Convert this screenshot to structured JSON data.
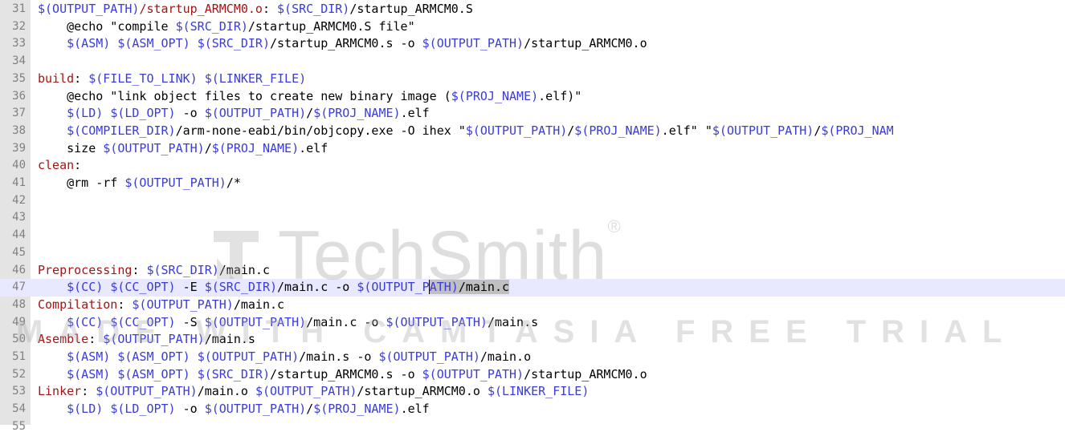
{
  "editor": {
    "current_line": 47,
    "lines": [
      {
        "n": "31",
        "tokens": [
          {
            "t": "$(OUTPUT_PATH)",
            "c": "var"
          },
          {
            "t": "/startup_ARMCM0.o",
            "c": "target"
          },
          {
            "t": ": ",
            "c": "plain"
          },
          {
            "t": "$(SRC_DIR)",
            "c": "var"
          },
          {
            "t": "/startup_ARMCM0.S",
            "c": "plain"
          }
        ]
      },
      {
        "n": "32",
        "tokens": [
          {
            "t": "    @echo \"compile ",
            "c": "plain"
          },
          {
            "t": "$(SRC_DIR)",
            "c": "var"
          },
          {
            "t": "/startup_ARMCM0.S file\"",
            "c": "plain"
          }
        ]
      },
      {
        "n": "33",
        "tokens": [
          {
            "t": "    ",
            "c": "plain"
          },
          {
            "t": "$(ASM)",
            "c": "var"
          },
          {
            "t": " ",
            "c": "plain"
          },
          {
            "t": "$(ASM_OPT)",
            "c": "var"
          },
          {
            "t": " ",
            "c": "plain"
          },
          {
            "t": "$(SRC_DIR)",
            "c": "var"
          },
          {
            "t": "/startup_ARMCM0.s -o ",
            "c": "plain"
          },
          {
            "t": "$(OUTPUT_PATH)",
            "c": "var"
          },
          {
            "t": "/startup_ARMCM0.o",
            "c": "plain"
          }
        ]
      },
      {
        "n": "34",
        "tokens": []
      },
      {
        "n": "35",
        "tokens": [
          {
            "t": "build",
            "c": "target"
          },
          {
            "t": ": ",
            "c": "plain"
          },
          {
            "t": "$(FILE_TO_LINK)",
            "c": "var"
          },
          {
            "t": " ",
            "c": "plain"
          },
          {
            "t": "$(LINKER_FILE)",
            "c": "var"
          }
        ]
      },
      {
        "n": "36",
        "tokens": [
          {
            "t": "    @echo \"link object files to create new binary image (",
            "c": "plain"
          },
          {
            "t": "$(PROJ_NAME)",
            "c": "var"
          },
          {
            "t": ".elf)\"",
            "c": "plain"
          }
        ]
      },
      {
        "n": "37",
        "tokens": [
          {
            "t": "    ",
            "c": "plain"
          },
          {
            "t": "$(LD)",
            "c": "var"
          },
          {
            "t": " ",
            "c": "plain"
          },
          {
            "t": "$(LD_OPT)",
            "c": "var"
          },
          {
            "t": " -o ",
            "c": "plain"
          },
          {
            "t": "$(OUTPUT_PATH)",
            "c": "var"
          },
          {
            "t": "/",
            "c": "plain"
          },
          {
            "t": "$(PROJ_NAME)",
            "c": "var"
          },
          {
            "t": ".elf",
            "c": "plain"
          }
        ]
      },
      {
        "n": "38",
        "tokens": [
          {
            "t": "    ",
            "c": "plain"
          },
          {
            "t": "$(COMPILER_DIR)",
            "c": "var"
          },
          {
            "t": "/arm-none-eabi/bin/objcopy.exe -O ihex \"",
            "c": "plain"
          },
          {
            "t": "$(OUTPUT_PATH)",
            "c": "var"
          },
          {
            "t": "/",
            "c": "plain"
          },
          {
            "t": "$(PROJ_NAME)",
            "c": "var"
          },
          {
            "t": ".elf\" \"",
            "c": "plain"
          },
          {
            "t": "$(OUTPUT_PATH)",
            "c": "var"
          },
          {
            "t": "/",
            "c": "plain"
          },
          {
            "t": "$(PROJ_NAM",
            "c": "var"
          }
        ]
      },
      {
        "n": "39",
        "tokens": [
          {
            "t": "    size ",
            "c": "plain"
          },
          {
            "t": "$(OUTPUT_PATH)",
            "c": "var"
          },
          {
            "t": "/",
            "c": "plain"
          },
          {
            "t": "$(PROJ_NAME)",
            "c": "var"
          },
          {
            "t": ".elf",
            "c": "plain"
          }
        ]
      },
      {
        "n": "40",
        "tokens": [
          {
            "t": "clean",
            "c": "target"
          },
          {
            "t": ":",
            "c": "plain"
          }
        ]
      },
      {
        "n": "41",
        "tokens": [
          {
            "t": "    @rm -rf ",
            "c": "plain"
          },
          {
            "t": "$(OUTPUT_PATH)",
            "c": "var"
          },
          {
            "t": "/*",
            "c": "plain"
          }
        ]
      },
      {
        "n": "42",
        "tokens": []
      },
      {
        "n": "43",
        "tokens": []
      },
      {
        "n": "44",
        "tokens": []
      },
      {
        "n": "45",
        "tokens": []
      },
      {
        "n": "46",
        "tokens": [
          {
            "t": "Preprocessing",
            "c": "target"
          },
          {
            "t": ": ",
            "c": "plain"
          },
          {
            "t": "$(SRC_DIR)",
            "c": "var"
          },
          {
            "t": "/main.c",
            "c": "plain"
          }
        ]
      },
      {
        "n": "47",
        "tokens": [
          {
            "t": "    ",
            "c": "plain"
          },
          {
            "t": "$(CC)",
            "c": "var"
          },
          {
            "t": " ",
            "c": "plain"
          },
          {
            "t": "$(CC_OPT)",
            "c": "var"
          },
          {
            "t": " -E ",
            "c": "plain"
          },
          {
            "t": "$(SRC_DIR)",
            "c": "var"
          },
          {
            "t": "/main.c -o ",
            "c": "plain"
          },
          {
            "t": "$(OUTPUT_P",
            "c": "var"
          },
          {
            "t": "ATH)",
            "c": "var",
            "sel": true,
            "caret": true
          },
          {
            "t": "/main.c",
            "c": "plain",
            "sel": true
          }
        ]
      },
      {
        "n": "48",
        "tokens": [
          {
            "t": "Compilation",
            "c": "target"
          },
          {
            "t": ": ",
            "c": "plain"
          },
          {
            "t": "$(OUTPUT_PATH)",
            "c": "var"
          },
          {
            "t": "/main.c",
            "c": "plain"
          }
        ]
      },
      {
        "n": "49",
        "tokens": [
          {
            "t": "    ",
            "c": "plain"
          },
          {
            "t": "$(CC)",
            "c": "var"
          },
          {
            "t": " ",
            "c": "plain"
          },
          {
            "t": "$(CC_OPT)",
            "c": "var"
          },
          {
            "t": " -S ",
            "c": "plain"
          },
          {
            "t": "$(OUTPUT_PATH)",
            "c": "var"
          },
          {
            "t": "/main.c -o ",
            "c": "plain"
          },
          {
            "t": "$(OUTPUT_PATH)",
            "c": "var"
          },
          {
            "t": "/main.s",
            "c": "plain"
          }
        ]
      },
      {
        "n": "50",
        "tokens": [
          {
            "t": "Asemble",
            "c": "target"
          },
          {
            "t": ": ",
            "c": "plain"
          },
          {
            "t": "$(OUTPUT_PATH)",
            "c": "var"
          },
          {
            "t": "/main.s",
            "c": "plain"
          }
        ]
      },
      {
        "n": "51",
        "tokens": [
          {
            "t": "    ",
            "c": "plain"
          },
          {
            "t": "$(ASM)",
            "c": "var"
          },
          {
            "t": " ",
            "c": "plain"
          },
          {
            "t": "$(ASM_OPT)",
            "c": "var"
          },
          {
            "t": " ",
            "c": "plain"
          },
          {
            "t": "$(OUTPUT_PATH)",
            "c": "var"
          },
          {
            "t": "/main.s -o ",
            "c": "plain"
          },
          {
            "t": "$(OUTPUT_PATH)",
            "c": "var"
          },
          {
            "t": "/main.o",
            "c": "plain"
          }
        ]
      },
      {
        "n": "52",
        "tokens": [
          {
            "t": "    ",
            "c": "plain"
          },
          {
            "t": "$(ASM)",
            "c": "var"
          },
          {
            "t": " ",
            "c": "plain"
          },
          {
            "t": "$(ASM_OPT)",
            "c": "var"
          },
          {
            "t": " ",
            "c": "plain"
          },
          {
            "t": "$(SRC_DIR)",
            "c": "var"
          },
          {
            "t": "/startup_ARMCM0.s -o ",
            "c": "plain"
          },
          {
            "t": "$(OUTPUT_PATH)",
            "c": "var"
          },
          {
            "t": "/startup_ARMCM0.o",
            "c": "plain"
          }
        ]
      },
      {
        "n": "53",
        "tokens": [
          {
            "t": "Linker",
            "c": "target"
          },
          {
            "t": ": ",
            "c": "plain"
          },
          {
            "t": "$(OUTPUT_PATH)",
            "c": "var"
          },
          {
            "t": "/main.o ",
            "c": "plain"
          },
          {
            "t": "$(OUTPUT_PATH)",
            "c": "var"
          },
          {
            "t": "/startup_ARMCM0.o ",
            "c": "plain"
          },
          {
            "t": "$(LINKER_FILE)",
            "c": "var"
          }
        ]
      },
      {
        "n": "54",
        "tokens": [
          {
            "t": "    ",
            "c": "plain"
          },
          {
            "t": "$(LD)",
            "c": "var"
          },
          {
            "t": " ",
            "c": "plain"
          },
          {
            "t": "$(LD_OPT)",
            "c": "var"
          },
          {
            "t": " -o ",
            "c": "plain"
          },
          {
            "t": "$(OUTPUT_PATH)",
            "c": "var"
          },
          {
            "t": "/",
            "c": "plain"
          },
          {
            "t": "$(PROJ_NAME)",
            "c": "var"
          },
          {
            "t": ".elf",
            "c": "plain"
          }
        ]
      },
      {
        "n": "55",
        "tokens": []
      }
    ]
  },
  "watermark": {
    "brand": "TechSmith",
    "registered": "®",
    "banner": "MADE WITH CAMTASIA FREE TRIAL"
  },
  "colors": {
    "variable": "#3b3bd6",
    "target": "#a31515",
    "line_number": "#808080",
    "gutter": "#e4e4e4",
    "current_line": "#e8e8ff"
  }
}
